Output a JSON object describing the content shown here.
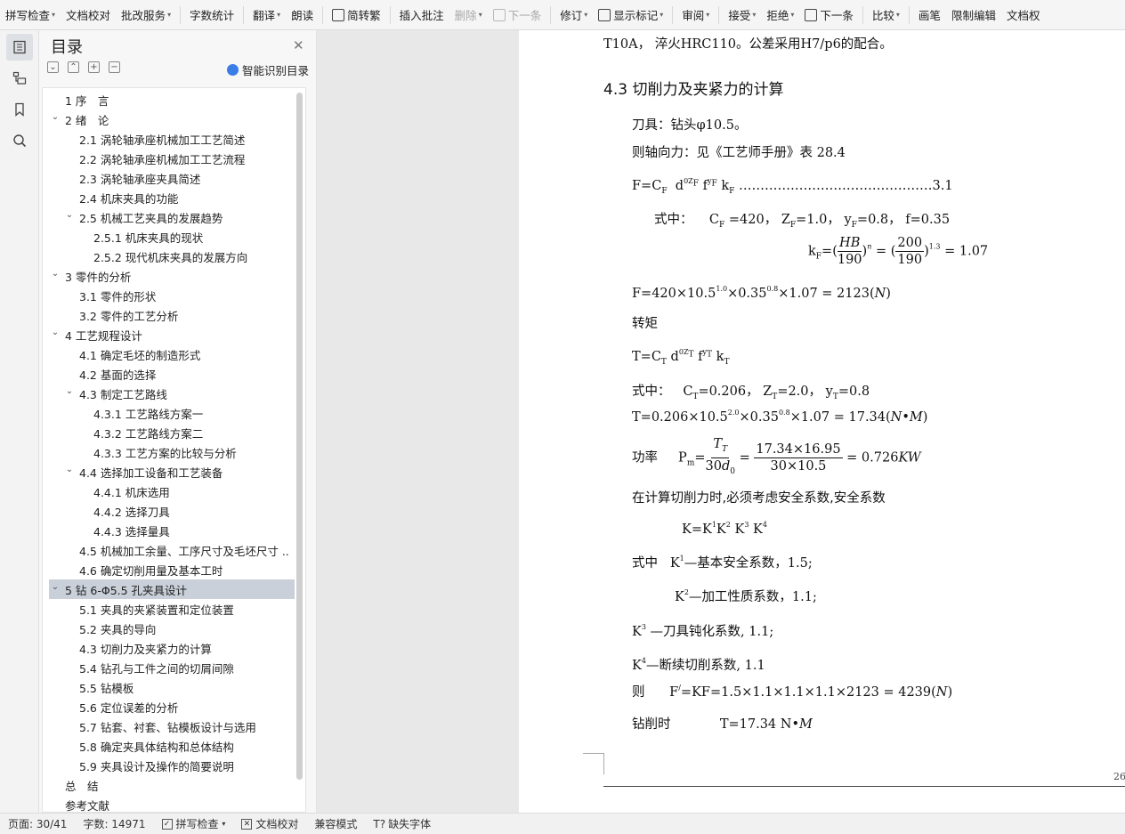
{
  "toolbar": {
    "items": [
      {
        "label": "拼写检查",
        "caret": true,
        "enabled": true
      },
      {
        "label": "文档校对",
        "caret": false,
        "enabled": true
      },
      {
        "label": "批改服务",
        "caret": true,
        "enabled": true
      },
      {
        "label": "字数统计",
        "caret": false,
        "enabled": true
      },
      {
        "label": "翻译",
        "caret": true,
        "enabled": true
      },
      {
        "label": "朗读",
        "caret": false,
        "enabled": true
      },
      {
        "label": "简转繁",
        "caret": false,
        "enabled": true
      },
      {
        "label": "插入批注",
        "caret": false,
        "enabled": true
      },
      {
        "label": "删除",
        "caret": true,
        "enabled": false
      },
      {
        "label": "下一条",
        "caret": false,
        "enabled": false
      },
      {
        "label": "修订",
        "caret": true,
        "enabled": true
      },
      {
        "label": "显示标记",
        "caret": true,
        "enabled": true
      },
      {
        "label": "审阅",
        "caret": true,
        "enabled": true
      },
      {
        "label": "接受",
        "caret": true,
        "enabled": true
      },
      {
        "label": "拒绝",
        "caret": true,
        "enabled": true
      },
      {
        "label": "下一条",
        "caret": false,
        "enabled": true
      },
      {
        "label": "比较",
        "caret": true,
        "enabled": true
      },
      {
        "label": "画笔",
        "caret": false,
        "enabled": true
      },
      {
        "label": "限制编辑",
        "caret": false,
        "enabled": true
      },
      {
        "label": "文档权",
        "caret": false,
        "enabled": true
      }
    ]
  },
  "sidebar_icons": [
    "toc-icon",
    "outline-icon",
    "bookmark-icon",
    "search-icon"
  ],
  "toc": {
    "title": "目录",
    "smart_label": "智能识别目录",
    "items": [
      {
        "label": "1 序　言",
        "level": 1,
        "arrow": ""
      },
      {
        "label": "2 绪　论",
        "level": 1,
        "arrow": "v"
      },
      {
        "label": "2.1 涡轮轴承座机械加工工艺简述",
        "level": 2,
        "arrow": ""
      },
      {
        "label": "2.2 涡轮轴承座机械加工工艺流程",
        "level": 2,
        "arrow": ""
      },
      {
        "label": "2.3 涡轮轴承座夹具简述",
        "level": 2,
        "arrow": ""
      },
      {
        "label": "2.4 机床夹具的功能",
        "level": 2,
        "arrow": ""
      },
      {
        "label": "2.5 机械工艺夹具的发展趋势",
        "level": 2,
        "arrow": "v"
      },
      {
        "label": "2.5.1 机床夹具的现状",
        "level": 3,
        "arrow": ""
      },
      {
        "label": "2.5.2 现代机床夹具的发展方向",
        "level": 3,
        "arrow": ""
      },
      {
        "label": "3 零件的分析",
        "level": 1,
        "arrow": "v"
      },
      {
        "label": "3.1 零件的形状",
        "level": 2,
        "arrow": ""
      },
      {
        "label": "3.2 零件的工艺分析",
        "level": 2,
        "arrow": ""
      },
      {
        "label": "4 工艺规程设计",
        "level": 1,
        "arrow": "v"
      },
      {
        "label": "4.1 确定毛坯的制造形式",
        "level": 2,
        "arrow": ""
      },
      {
        "label": "4.2 基面的选择",
        "level": 2,
        "arrow": ""
      },
      {
        "label": "4.3 制定工艺路线",
        "level": 2,
        "arrow": "v"
      },
      {
        "label": "4.3.1 工艺路线方案一",
        "level": 3,
        "arrow": ""
      },
      {
        "label": "4.3.2 工艺路线方案二",
        "level": 3,
        "arrow": ""
      },
      {
        "label": "4.3.3 工艺方案的比较与分析",
        "level": 3,
        "arrow": ""
      },
      {
        "label": "4.4 选择加工设备和工艺装备",
        "level": 2,
        "arrow": "v"
      },
      {
        "label": "4.4.1 机床选用",
        "level": 3,
        "arrow": ""
      },
      {
        "label": "4.4.2 选择刀具",
        "level": 3,
        "arrow": ""
      },
      {
        "label": "4.4.3 选择量具",
        "level": 3,
        "arrow": ""
      },
      {
        "label": "4.5 机械加工余量、工序尺寸及毛坯尺寸 ...",
        "level": 2,
        "arrow": ""
      },
      {
        "label": "4.6 确定切削用量及基本工时",
        "level": 2,
        "arrow": ""
      },
      {
        "label": "5 钻 6-Φ5.5 孔夹具设计",
        "level": 1,
        "arrow": "v",
        "selected": true
      },
      {
        "label": "5.1 夹具的夹紧装置和定位装置",
        "level": 2,
        "arrow": ""
      },
      {
        "label": "5.2 夹具的导向",
        "level": 2,
        "arrow": ""
      },
      {
        "label": "4.3 切削力及夹紧力的计算",
        "level": 2,
        "arrow": ""
      },
      {
        "label": "5.4 钻孔与工件之间的切屑间隙",
        "level": 2,
        "arrow": ""
      },
      {
        "label": "5.5 钻模板",
        "level": 2,
        "arrow": ""
      },
      {
        "label": "5.6 定位误差的分析",
        "level": 2,
        "arrow": ""
      },
      {
        "label": "5.7 钻套、衬套、钻模板设计与选用",
        "level": 2,
        "arrow": ""
      },
      {
        "label": "5.8 确定夹具体结构和总体结构",
        "level": 2,
        "arrow": ""
      },
      {
        "label": "5.9 夹具设计及操作的简要说明",
        "level": 2,
        "arrow": ""
      },
      {
        "label": "总　结",
        "level": 1,
        "arrow": ""
      },
      {
        "label": "参考文献",
        "level": 1,
        "arrow": ""
      }
    ]
  },
  "document": {
    "top_line": "T10A，  淬火HRC110。公差采用H7/p6的配合。",
    "heading": "4.3  切削力及夹紧力的计算",
    "tool": "刀具：钻头φ10.5。",
    "axial": "则轴向力：见《工艺师手册》表 28.4",
    "f_formula_dots": "………………………………………3.1",
    "where1": "式中：",
    "cf_vals": "=420，  Z",
    "zf_vals": "=1.0，  y",
    "yf_vals": "=0.8，  f=0.35",
    "f_result": "F=420×10.5",
    "f_result_tail": "×0.35",
    "f_result_end": "×1.07 = 2123(",
    "torque_label": "转矩",
    "t_where": "式中：",
    "t_vals": "=0.206，  Z",
    "t_vals2": "=2.0，  y",
    "t_vals3": "=0.8",
    "t_result": "T=0.206×10.5",
    "t_result_end": "×1.07 = 17.34(",
    "power_label": "功率",
    "power_num": "17.34×16.95",
    "power_den": "30×10.5",
    "power_result": "= 0.726",
    "safety_text": "在计算切削力时,必须考虑安全系数,安全系数",
    "k_formula": "K=K",
    "k1_text": "—基本安全系数，1.5;",
    "k1_prefix": "式中",
    "k2_text": "—加工性质系数，1.1;",
    "k3_text": "—刀具钝化系数, 1.1;",
    "k4_text": "—断续切削系数, 1.1",
    "f_prime_label": "则",
    "f_prime_text": "=KF=1.5",
    "f_prime_tail": "×1.1×1.1×1.1×2123 = 4239(",
    "drill_label": "钻削时",
    "drill_value": "T=17.34 N",
    "page_number": "26"
  },
  "status": {
    "page": "页面: 30/41",
    "words": "字数: 14971",
    "spell": "拼写检查",
    "proof": "文档校对",
    "compat": "兼容模式",
    "font": "缺失字体"
  }
}
